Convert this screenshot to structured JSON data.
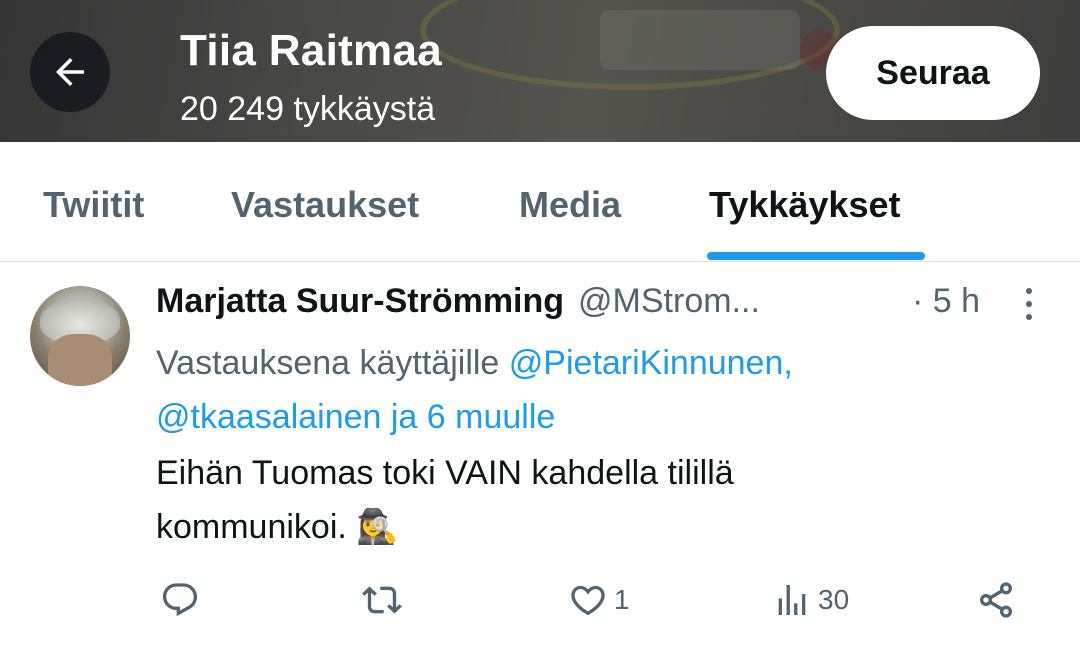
{
  "header": {
    "profile_name": "Tiia Raitmaa",
    "likes_count": "20 249 tykkäystä",
    "follow_label": "Seuraa",
    "back_icon": "arrow-left-icon"
  },
  "tabs": [
    {
      "label": "Twiitit",
      "active": false
    },
    {
      "label": "Vastaukset",
      "active": false
    },
    {
      "label": "Media",
      "active": false
    },
    {
      "label": "Tykkäykset",
      "active": true
    }
  ],
  "tweet": {
    "author_name": "Marjatta Suur-Strömming",
    "author_handle": "@MStrom...",
    "time": "· 5 h",
    "reply_prefix": "Vastauksena käyttäjille ",
    "reply_mention1": "@PietariKinnunen,",
    "reply_mention2": "@tkaasalainen ja 6 muulle",
    "text_line1": "Eihän Tuomas toki VAIN kahdella tilillä",
    "text_line2": "kommunikoi. 🕵️‍♀️",
    "actions": {
      "reply_count": "",
      "retweet_count": "",
      "like_count": "1",
      "views_count": "30"
    }
  },
  "colors": {
    "accent": "#1d9bf0",
    "secondary_text": "#536471",
    "primary_text": "#0f1419"
  }
}
